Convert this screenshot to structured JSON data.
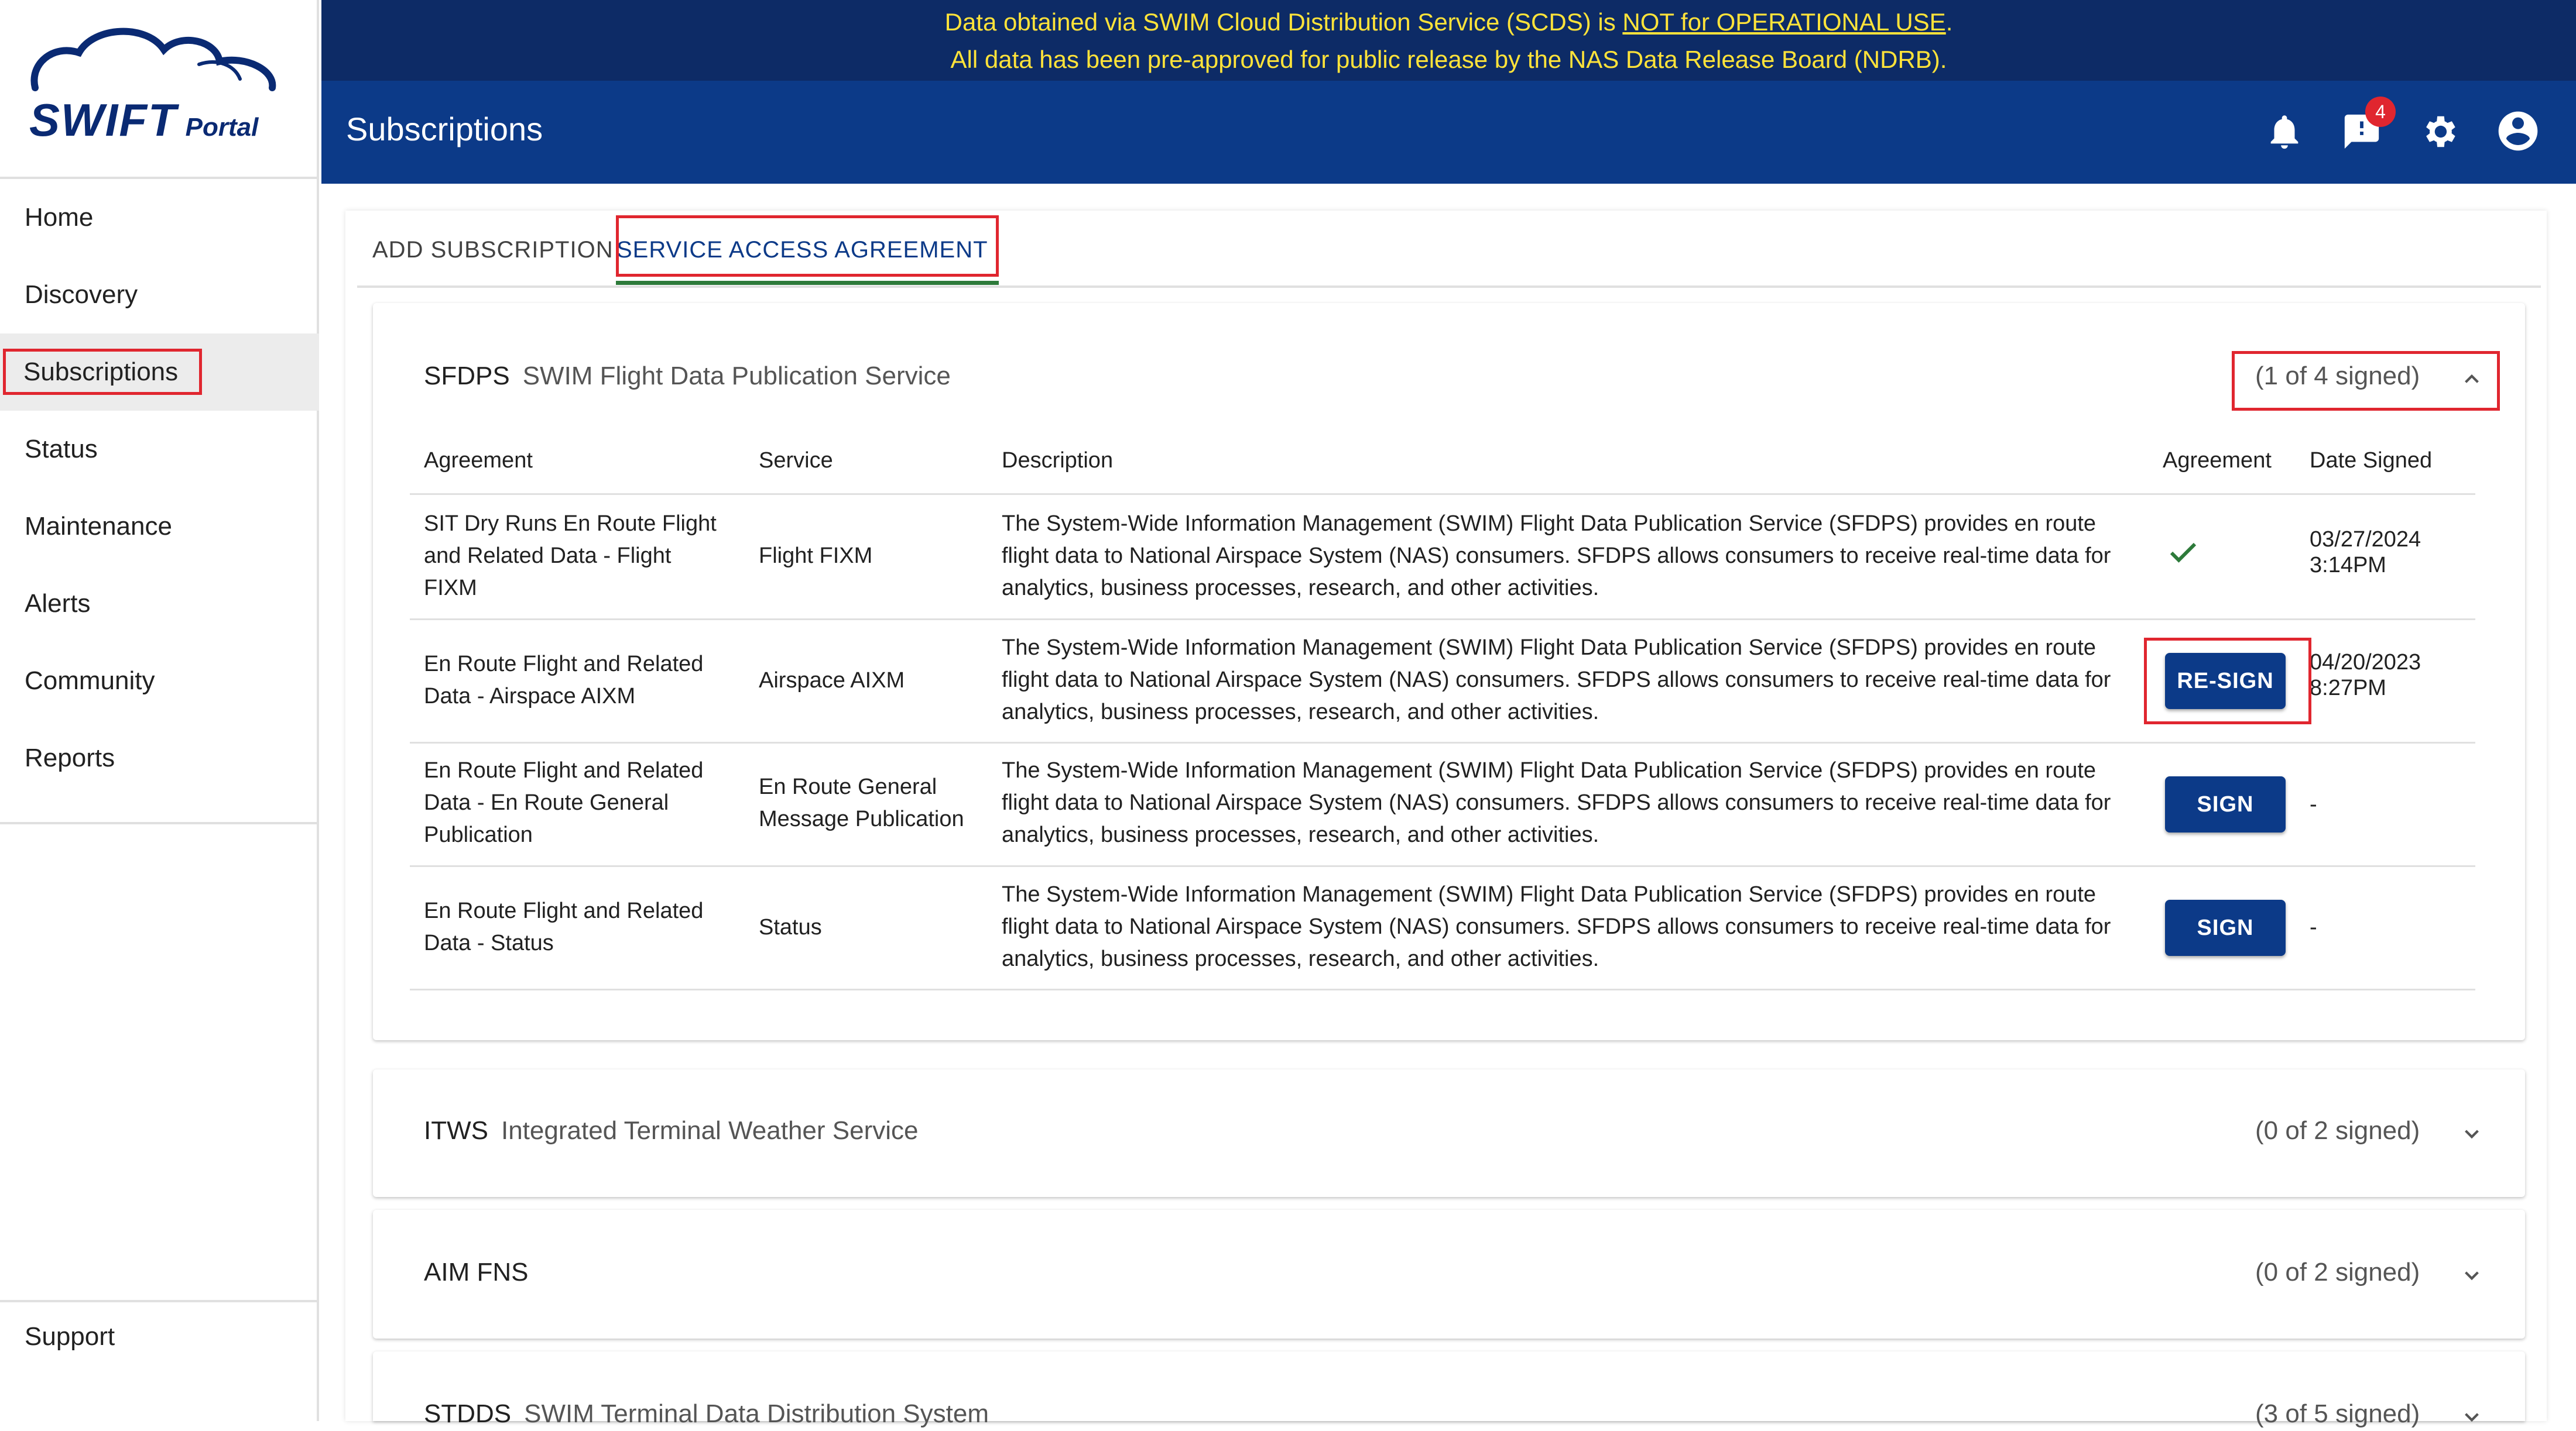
{
  "app": {
    "logo_text": "SWIFT",
    "logo_sub": "Portal"
  },
  "banner": {
    "line1_prefix": "Data obtained via SWIM Cloud Distribution Service (SCDS) is ",
    "line1_link": "NOT for OPERATIONAL USE",
    "line1_suffix": ".",
    "line2": "All data has been pre-approved for public release by the NAS Data Release Board (NDRB)."
  },
  "header": {
    "title": "Subscriptions",
    "message_badge": "4"
  },
  "sidebar": {
    "items": [
      {
        "label": "Home"
      },
      {
        "label": "Discovery"
      },
      {
        "label": "Subscriptions"
      },
      {
        "label": "Status"
      },
      {
        "label": "Maintenance"
      },
      {
        "label": "Alerts"
      },
      {
        "label": "Community"
      },
      {
        "label": "Reports"
      }
    ],
    "support": "Support"
  },
  "tabs": [
    {
      "label": "ADD SUBSCRIPTION"
    },
    {
      "label": "SERVICE ACCESS AGREEMENT"
    }
  ],
  "panels": [
    {
      "code": "SFDPS",
      "name": "SWIM Flight Data Publication Service",
      "count": "(1 of 4 signed)",
      "columns": [
        "Agreement",
        "Service",
        "Description",
        "Agreement",
        "Date Signed"
      ],
      "rows": [
        {
          "agreement": "SIT Dry Runs En Route Flight and Related Data - Flight FIXM",
          "service": "Flight FIXM",
          "description": "The System-Wide Information Management (SWIM) Flight Data Publication Service (SFDPS) provides en route flight data to National Airspace System (NAS) consumers. SFDPS allows consumers to receive real-time data for analytics, business processes, research, and other activities.",
          "status": "signed",
          "date": "03/27/2024",
          "time": "3:14PM"
        },
        {
          "agreement": "En Route Flight and Related Data - Airspace AIXM",
          "service": "Airspace AIXM",
          "description": "The System-Wide Information Management (SWIM) Flight Data Publication Service (SFDPS) provides en route flight data to National Airspace System (NAS) consumers. SFDPS allows consumers to receive real-time data for analytics, business processes, research, and other activities.",
          "button": "RE-SIGN",
          "date": "04/20/2023",
          "time": "8:27PM"
        },
        {
          "agreement": "En Route Flight and Related Data - En Route General Publication",
          "service": "En Route General Message Publication",
          "description": "The System-Wide Information Management (SWIM) Flight Data Publication Service (SFDPS) provides en route flight data to National Airspace System (NAS) consumers. SFDPS allows consumers to receive real-time data for analytics, business processes, research, and other activities.",
          "button": "SIGN",
          "date": "-"
        },
        {
          "agreement": "En Route Flight and Related Data - Status",
          "service": "Status",
          "description": "The System-Wide Information Management (SWIM) Flight Data Publication Service (SFDPS) provides en route flight data to National Airspace System (NAS) consumers. SFDPS allows consumers to receive real-time data for analytics, business processes, research, and other activities.",
          "button": "SIGN",
          "date": "-"
        }
      ]
    },
    {
      "code": "ITWS",
      "name": "Integrated Terminal Weather Service",
      "count": "(0 of 2 signed)"
    },
    {
      "code": "AIM FNS",
      "name": "",
      "count": "(0 of 2 signed)"
    },
    {
      "code": "STDDS",
      "name": "SWIM Terminal Data Distribution System",
      "count": "(3 of 5 signed)"
    }
  ],
  "colors": {
    "navy": "#0c3a88",
    "banner": "#0d2b66",
    "banner_text": "#ffe33a",
    "highlight": "#e0262f",
    "check": "#2d7a3a"
  }
}
